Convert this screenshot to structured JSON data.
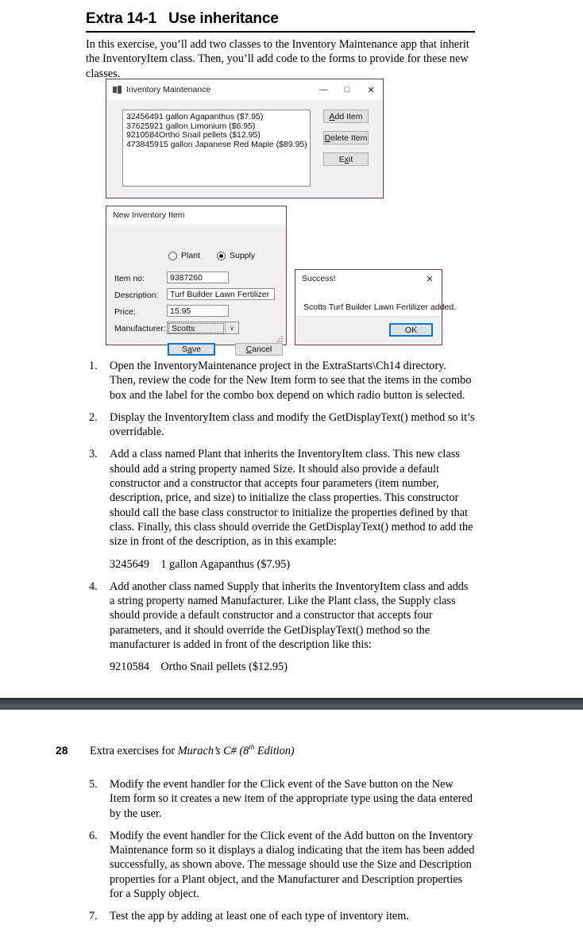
{
  "exercise": {
    "title": "Extra 14-1   Use inheritance",
    "intro": "In this exercise, you’ll add two classes to the Inventory Maintenance app that inherit the InventoryItem class. Then, you’ll add code to the forms to provide for these new classes."
  },
  "inventory_window": {
    "title": "Inventory Maintenance",
    "minimize_label": "—",
    "maximize_label": "□",
    "close_label": "✕",
    "list_items": [
      {
        "number": "3245649",
        "description": "1 gallon Agapanthus ($7.95)"
      },
      {
        "number": "3762592",
        "description": "1 gallon Limonium ($6.95)"
      },
      {
        "number": "9210584",
        "description": "Ortho Snail pellets ($12.95)"
      },
      {
        "number": "4738459",
        "description": "15 gallon Japanese Red Maple ($89.95)"
      }
    ],
    "buttons": {
      "add": {
        "pre": "",
        "key": "A",
        "post": "dd Item"
      },
      "delete": {
        "pre": "",
        "key": "D",
        "post": "elete Item"
      },
      "exit": {
        "pre": "E",
        "key": "x",
        "post": "it"
      }
    }
  },
  "new_item_dialog": {
    "title": "New Inventory Item",
    "radio_plant": "Plant",
    "radio_supply": "Supply",
    "plant_selected": false,
    "supply_selected": true,
    "labels": {
      "item_no": "Item no:",
      "description": "Description:",
      "price": "Price:",
      "manufacturer": "Manufacturer:"
    },
    "values": {
      "item_no": "9387260",
      "description": "Turf Builder Lawn Fertilizer",
      "price": "15.95",
      "manufacturer": "Scotts"
    },
    "buttons": {
      "save": {
        "pre": "S",
        "key": "a",
        "post": "ve"
      },
      "cancel": {
        "pre": "",
        "key": "C",
        "post": "ancel"
      }
    },
    "combo_arrow": "∨"
  },
  "success_dialog": {
    "title": "Success!",
    "close_label": "✕",
    "message": "Scotts Turf Builder Lawn Fertilizer added.",
    "ok_label": "OK"
  },
  "steps_page1": [
    {
      "marker": "1.",
      "text": "Open the InventoryMaintenance project in the ExtraStarts\\Ch14 directory. Then, review the code for the New Item form to see that the items in the combo box and the label for the combo box depend on which radio button is selected.",
      "example": null
    },
    {
      "marker": "2.",
      "text": "Display the InventoryItem class and modify the GetDisplayText() method so it’s overridable.",
      "example": null
    },
    {
      "marker": "3.",
      "text": "Add a class named Plant that inherits the InventoryItem class. This new class should add a string property named Size. It should also provide a default constructor and a constructor that accepts four parameters (item number, description, price, and size) to initialize the class properties. This constructor should call the base class constructor to initialize the properties defined by that class. Finally, this class should override the GetDisplayText() method to add the size in front of the description, as in this example:",
      "example": "3245649    1 gallon Agapanthus ($7.95)"
    },
    {
      "marker": "4.",
      "text": "Add another class named Supply that inherits the InventoryItem class and adds a string property named Manufacturer. Like the Plant class, the Supply class should provide a default constructor and a constructor that accepts four parameters, and it should override the GetDisplayText() method so the manufacturer is added in front of the description like this:",
      "example": "9210584    Ortho Snail pellets ($12.95)"
    }
  ],
  "page2": {
    "page_number": "28",
    "running_head_prefix": "Extra exercises for ",
    "running_head_italic_1": "Murach’s C# (8",
    "running_head_sup": "th",
    "running_head_italic_2": " Edition)",
    "steps": [
      {
        "marker": "5.",
        "text": "Modify the event handler for the Click event of the Save button on the New Item form so it creates a new item of the appropriate type using the data entered by the user."
      },
      {
        "marker": "6.",
        "text": "Modify the event handler for the Click event of the Add button on the Inventory Maintenance form so it displays a dialog indicating that the item has been added successfully, as shown above. The message should use the Size and Description properties for a Plant object, and the Manufacturer and Description properties for a Supply object."
      },
      {
        "marker": "7.",
        "text": "Test the app by adding at least one of each type of inventory item."
      }
    ]
  },
  "colors": {
    "window_border": "#6b3a5b",
    "window_face": "#f0f0f0",
    "focus_blue": "#0078d7",
    "separator": "#3f4549"
  }
}
